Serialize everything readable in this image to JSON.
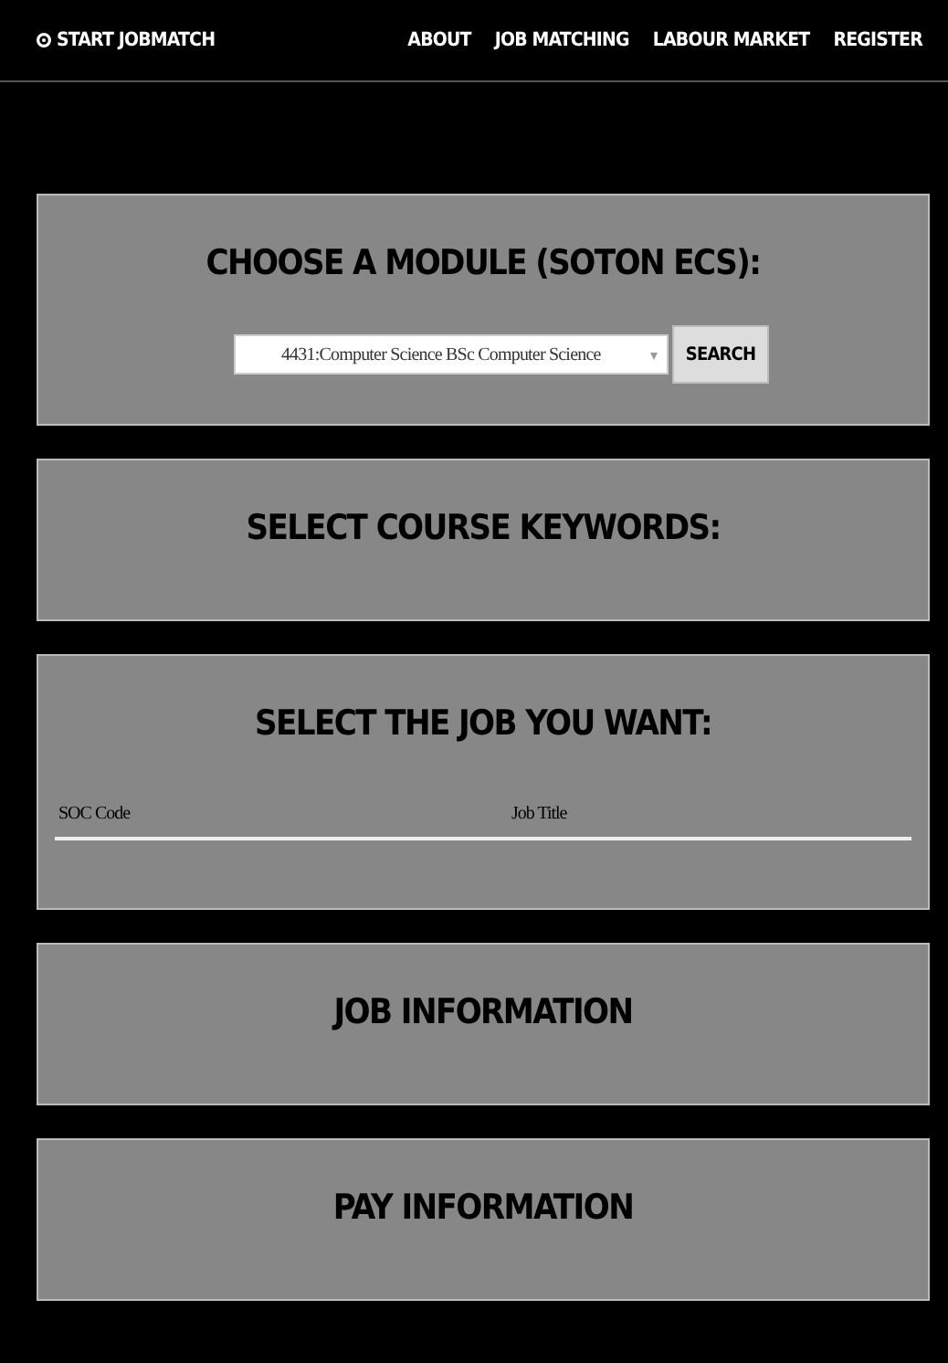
{
  "navbar": {
    "brand": "START JOBMATCH",
    "links": [
      "ABOUT",
      "JOB MATCHING",
      "LABOUR MARKET",
      "REGISTER"
    ]
  },
  "panels": [
    {
      "kind": "module",
      "title": "CHOOSE A MODULE (SOTON ECS):",
      "select_value": "4431:Computer Science BSc Computer Science",
      "button": "SEARCH"
    },
    {
      "kind": "plain",
      "title": "SELECT COURSE KEYWORDS:"
    },
    {
      "kind": "table",
      "title": "SELECT THE JOB YOU WANT:",
      "columns": [
        "SOC Code",
        "Job Title"
      ]
    },
    {
      "kind": "plain",
      "title": "JOB INFORMATION"
    },
    {
      "kind": "plain",
      "title": "PAY INFORMATION"
    }
  ]
}
